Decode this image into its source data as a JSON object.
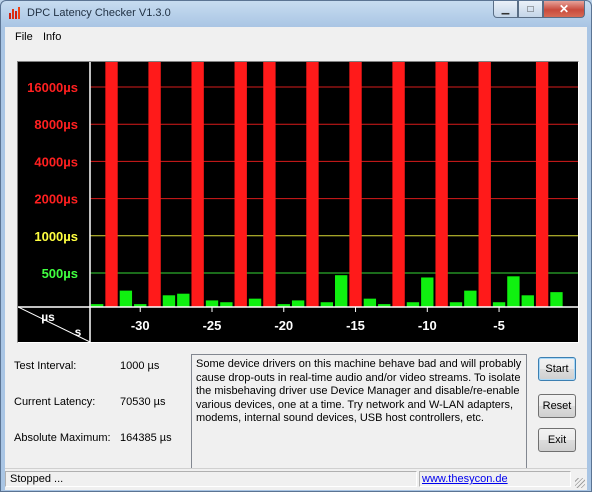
{
  "window": {
    "title": "DPC Latency Checker V1.3.0",
    "caption_buttons": {
      "minimize": "▁",
      "maximize": "□",
      "close": "✕"
    }
  },
  "menu": [
    "File",
    "Info"
  ],
  "chart_data": {
    "type": "bar",
    "title": "",
    "y_scale": "log2",
    "y_unit": "µs",
    "x_unit": "s",
    "corner_labels": {
      "y": "µs",
      "x": "s"
    },
    "y_ticks": [
      {
        "label": "16000µs",
        "value": 16000,
        "color": "#ff2020"
      },
      {
        "label": "8000µs",
        "value": 8000,
        "color": "#ff2020"
      },
      {
        "label": "4000µs",
        "value": 4000,
        "color": "#ff2020"
      },
      {
        "label": "2000µs",
        "value": 2000,
        "color": "#ff2020"
      },
      {
        "label": "1000µs",
        "value": 1000,
        "color": "#ffff40"
      },
      {
        "label": "500µs",
        "value": 500,
        "color": "#40ff40"
      }
    ],
    "x_ticks": [
      -30,
      -25,
      -20,
      -15,
      -10,
      -5
    ],
    "x_range": [
      -33,
      0
    ],
    "bars": [
      {
        "t": -33,
        "value": 280,
        "color": "green"
      },
      {
        "t": -32,
        "value": 70530,
        "color": "red"
      },
      {
        "t": -31,
        "value": 360,
        "color": "green"
      },
      {
        "t": -30,
        "value": 280,
        "color": "green"
      },
      {
        "t": -29,
        "value": 164385,
        "color": "red"
      },
      {
        "t": -28,
        "value": 330,
        "color": "green"
      },
      {
        "t": -27,
        "value": 340,
        "color": "green"
      },
      {
        "t": -26,
        "value": 164385,
        "color": "red"
      },
      {
        "t": -25,
        "value": 300,
        "color": "green"
      },
      {
        "t": -24,
        "value": 290,
        "color": "green"
      },
      {
        "t": -23,
        "value": 164385,
        "color": "red"
      },
      {
        "t": -22,
        "value": 310,
        "color": "green"
      },
      {
        "t": -21,
        "value": 164385,
        "color": "red"
      },
      {
        "t": -20,
        "value": 280,
        "color": "green"
      },
      {
        "t": -19,
        "value": 300,
        "color": "green"
      },
      {
        "t": -18,
        "value": 164385,
        "color": "red"
      },
      {
        "t": -17,
        "value": 290,
        "color": "green"
      },
      {
        "t": -16,
        "value": 480,
        "color": "green"
      },
      {
        "t": -15,
        "value": 164385,
        "color": "red"
      },
      {
        "t": -14,
        "value": 310,
        "color": "green"
      },
      {
        "t": -13,
        "value": 280,
        "color": "green"
      },
      {
        "t": -12,
        "value": 164385,
        "color": "red"
      },
      {
        "t": -11,
        "value": 290,
        "color": "green"
      },
      {
        "t": -10,
        "value": 460,
        "color": "green"
      },
      {
        "t": -9,
        "value": 164385,
        "color": "red"
      },
      {
        "t": -8,
        "value": 290,
        "color": "green"
      },
      {
        "t": -7,
        "value": 360,
        "color": "green"
      },
      {
        "t": -6,
        "value": 164385,
        "color": "red"
      },
      {
        "t": -5,
        "value": 290,
        "color": "green"
      },
      {
        "t": -4,
        "value": 470,
        "color": "green"
      },
      {
        "t": -3,
        "value": 330,
        "color": "green"
      },
      {
        "t": -2,
        "value": 164385,
        "color": "red"
      },
      {
        "t": -1,
        "value": 350,
        "color": "green"
      }
    ],
    "colors": {
      "background": "#000000",
      "red_bar": "#ff1a1a",
      "green_bar": "#10f010",
      "axis": "#ffffff"
    }
  },
  "stats": {
    "interval_label": "Test Interval:",
    "interval_value": "1000 µs",
    "current_label": "Current Latency:",
    "current_value": "70530 µs",
    "max_label": "Absolute Maximum:",
    "max_value": "164385 µs"
  },
  "info_text": "Some device drivers on this machine behave bad and will probably cause drop-outs in real-time audio and/or video streams. To isolate the misbehaving driver use Device Manager and disable/re-enable various devices, one at a time. Try network and W-LAN adapters, modems, internal sound devices, USB host controllers, etc.",
  "buttons": {
    "start": "Start",
    "reset": "Reset",
    "exit": "Exit"
  },
  "status": {
    "text": "Stopped ...",
    "link": "www.thesycon.de"
  }
}
